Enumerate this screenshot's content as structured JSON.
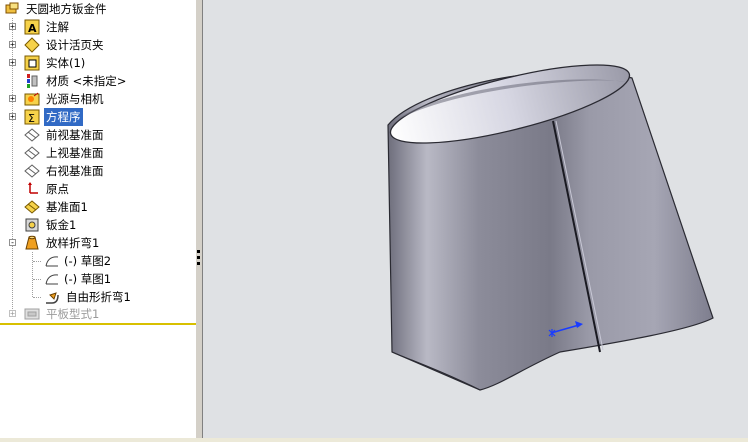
{
  "tree": {
    "root_label": "天圆地方钣金件",
    "items": [
      {
        "label": "注解",
        "icon": "annotation-icon",
        "expander": "+"
      },
      {
        "label": "设计活页夹",
        "icon": "design-binder-icon",
        "expander": "+"
      },
      {
        "label": "实体(1)",
        "icon": "solid-bodies-icon",
        "expander": "+"
      },
      {
        "label": "材质 <未指定>",
        "icon": "material-icon",
        "expander": ""
      },
      {
        "label": "光源与相机",
        "icon": "lights-cameras-icon",
        "expander": "+"
      },
      {
        "label": "方程序",
        "icon": "equations-icon",
        "expander": "+",
        "selected": true
      },
      {
        "label": "前视基准面",
        "icon": "plane-icon",
        "expander": ""
      },
      {
        "label": "上视基准面",
        "icon": "plane-icon",
        "expander": ""
      },
      {
        "label": "右视基准面",
        "icon": "plane-icon",
        "expander": ""
      },
      {
        "label": "原点",
        "icon": "origin-icon",
        "expander": ""
      },
      {
        "label": "基准面1",
        "icon": "plane-feature-icon",
        "expander": ""
      },
      {
        "label": "钣金1",
        "icon": "sheet-metal-icon",
        "expander": ""
      },
      {
        "label": "放样折弯1",
        "icon": "lofted-bend-icon",
        "expander": "-"
      },
      {
        "label": "(-) 草图2",
        "icon": "sketch-icon",
        "expander": "",
        "child": true
      },
      {
        "label": "(-) 草图1",
        "icon": "sketch-icon",
        "expander": "",
        "child": true
      },
      {
        "label": "自由形折弯1",
        "icon": "bend-icon",
        "expander": "",
        "child": true
      },
      {
        "label": "平板型式1",
        "icon": "flat-pattern-icon",
        "expander": "+",
        "suppressed": true
      }
    ]
  },
  "colors": {
    "selection": "#316ac5",
    "viewport_bg": "#dfe1e4",
    "rollback_bar": "#d8c000",
    "model_body": "#8a8a9a"
  }
}
